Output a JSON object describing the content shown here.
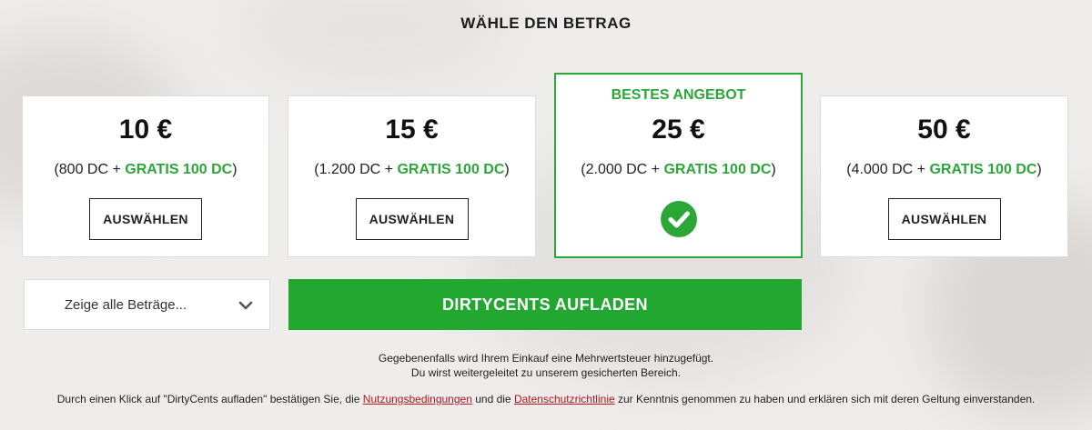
{
  "heading": "WÄHLE DEN BETRAG",
  "cards": [
    {
      "price": "10 €",
      "dc_open": "(800 DC + ",
      "bonus": "GRATIS 100 DC",
      "dc_close": ")",
      "button": "AUSWÄHLEN"
    },
    {
      "price": "15 €",
      "dc_open": "(1.200 DC + ",
      "bonus": "GRATIS 100 DC",
      "dc_close": ")",
      "button": "AUSWÄHLEN"
    },
    {
      "badge": "BESTES ANGEBOT",
      "price": "25 €",
      "dc_open": "(2.000 DC + ",
      "bonus": "GRATIS 100 DC",
      "dc_close": ")",
      "selected": true
    },
    {
      "price": "50 €",
      "dc_open": "(4.000 DC + ",
      "bonus": "GRATIS 100 DC",
      "dc_close": ")",
      "button": "AUSWÄHLEN"
    }
  ],
  "dropdown": {
    "label": "Zeige alle Beträge...",
    "icon": "chevron-down-icon"
  },
  "cta": {
    "label": "DIRTYCENTS AUFLADEN"
  },
  "notes": {
    "line1": "Gegebenenfalls wird Ihrem Einkauf eine Mehrwertsteuer hinzugefügt.",
    "line2": "Du wirst weitergeleitet zu unserem gesicherten Bereich."
  },
  "legal": {
    "part1": "Durch einen Klick auf \"DirtyCents aufladen\" bestätigen Sie, die ",
    "link1": "Nutzungsbedingungen",
    "part2": " und die ",
    "link2": "Datenschutzrichtlinie",
    "part3": " zur Kenntnis genommen zu haben und erklären sich mit deren Geltung einverstanden."
  },
  "colors": {
    "accent": "#22a831",
    "link": "#b3141e",
    "background": "#eeedec"
  }
}
